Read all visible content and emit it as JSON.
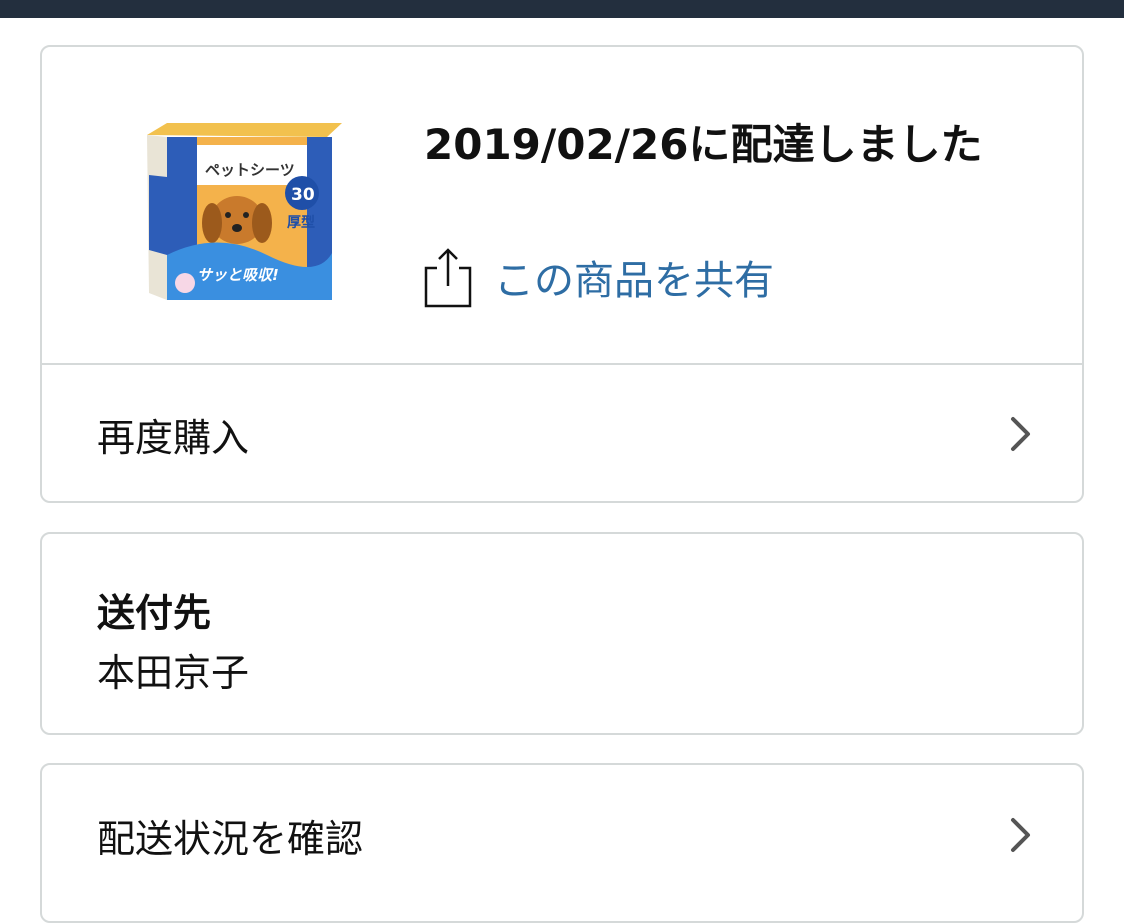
{
  "order": {
    "delivery_status": "2019/02/26に配達しました",
    "share_label": "この商品を共有",
    "product_image": {
      "brand_text": "ペットシーツ",
      "count_text": "30",
      "type_text": "厚型",
      "slogan_text": "サッと吸収!"
    }
  },
  "actions": {
    "buy_again_label": "再度購入",
    "track_label": "配送状況を確認"
  },
  "shipping": {
    "title": "送付先",
    "recipient": "本田京子"
  },
  "colors": {
    "topbar": "#232f3e",
    "link": "#2e6da4",
    "border": "#d5d9d9"
  }
}
